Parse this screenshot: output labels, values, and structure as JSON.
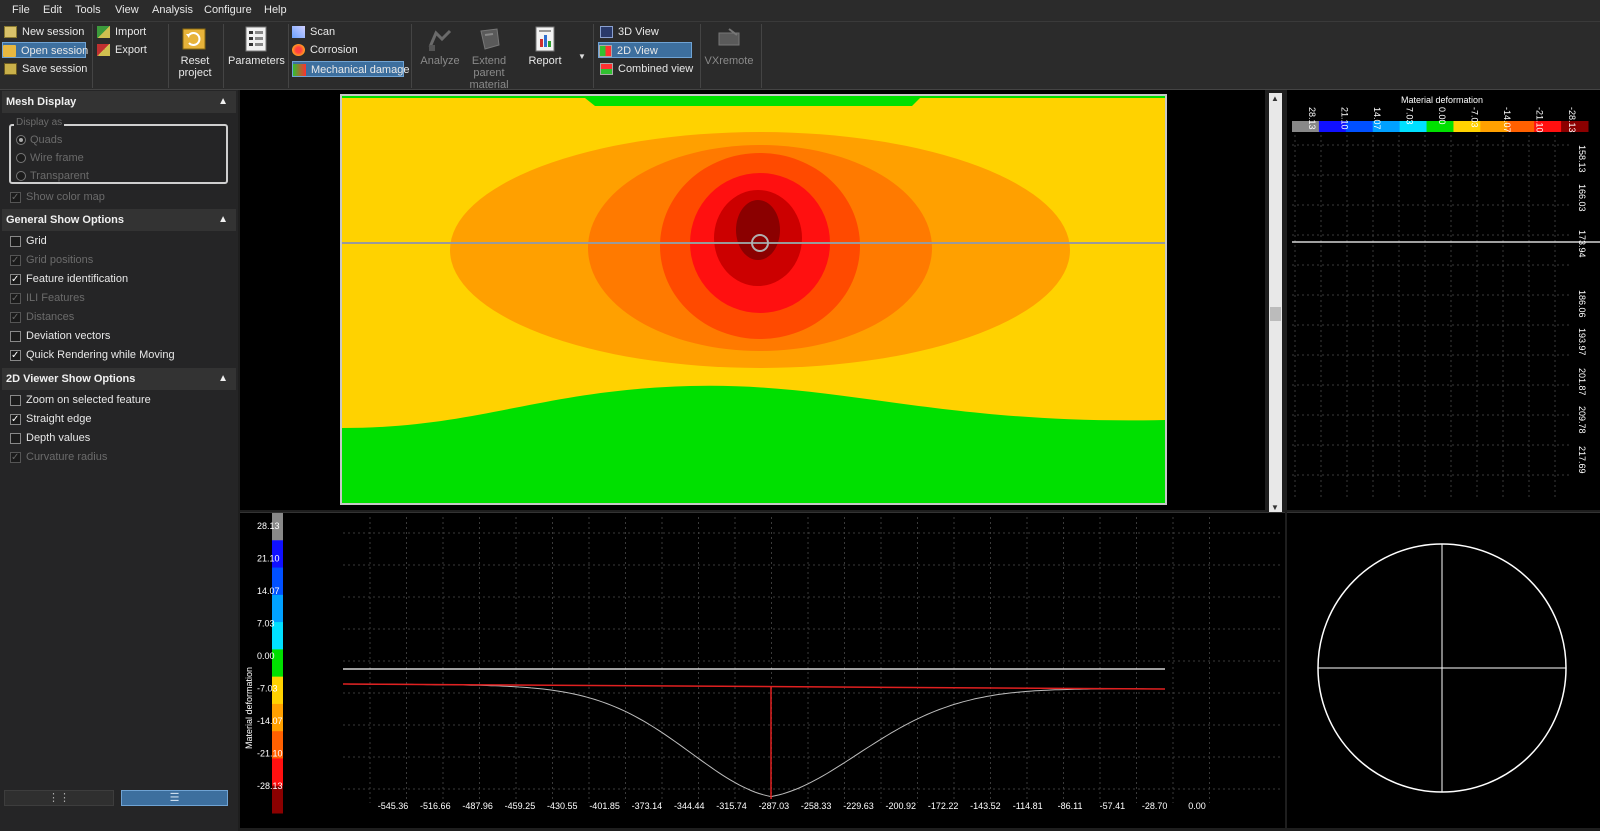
{
  "menu": [
    "File",
    "Edit",
    "Tools",
    "View",
    "Analysis",
    "Configure",
    "Help"
  ],
  "ribbon": {
    "session": {
      "new": "New session",
      "open": "Open session",
      "save": "Save session"
    },
    "io": {
      "import": "Import",
      "export": "Export"
    },
    "reset_line1": "Reset",
    "reset_line2": "project",
    "parameters": "Parameters",
    "modes": {
      "scan": "Scan",
      "corrosion": "Corrosion",
      "mechanical": "Mechanical damage"
    },
    "analyze": "Analyze",
    "extend_line1": "Extend",
    "extend_line2": "parent",
    "extend_line3": "material",
    "report": "Report",
    "views": {
      "v3d": "3D View",
      "v2d": "2D View",
      "combined": "Combined view"
    },
    "vxremote": "VXremote"
  },
  "left_panel": {
    "mesh_display": {
      "title": "Mesh Display",
      "display_as": "Display as",
      "radios": [
        "Quads",
        "Wire frame",
        "Transparent"
      ],
      "show_color_map": "Show color map"
    },
    "general": {
      "title": "General Show Options",
      "items": [
        {
          "label": "Grid",
          "checked": false,
          "enabled": true
        },
        {
          "label": "Grid positions",
          "checked": true,
          "enabled": false
        },
        {
          "label": "Feature identification",
          "checked": true,
          "enabled": true
        },
        {
          "label": "ILI Features",
          "checked": true,
          "enabled": false
        },
        {
          "label": "Distances",
          "checked": true,
          "enabled": false
        },
        {
          "label": "Deviation vectors",
          "checked": false,
          "enabled": true
        },
        {
          "label": "Quick Rendering while Moving",
          "checked": true,
          "enabled": true
        }
      ]
    },
    "viewer2d": {
      "title": "2D Viewer Show Options",
      "items": [
        {
          "label": "Zoom on selected feature",
          "checked": false,
          "enabled": true
        },
        {
          "label": "Straight edge",
          "checked": true,
          "enabled": true
        },
        {
          "label": "Depth values",
          "checked": false,
          "enabled": true
        },
        {
          "label": "Curvature radius",
          "checked": true,
          "enabled": false
        }
      ]
    }
  },
  "colors": {
    "yellow": "#ffd200",
    "orange": "#ffa000",
    "dark_orange": "#ff7a00",
    "red_orange": "#ff4a00",
    "red": "#ff1010",
    "dark_red": "#cc0000",
    "maroon": "#8b0000",
    "green": "#00e000",
    "accent_blue": "#3d6f9e"
  },
  "profile": {
    "axis_title": "Material deformation",
    "scale_labels": [
      "28.13",
      "21.10",
      "14.07",
      "7.03",
      "0.00",
      "-7.03",
      "-14.07",
      "-21.10",
      "-28.13"
    ],
    "x_labels": [
      "-545.36",
      "-516.66",
      "-487.96",
      "-459.25",
      "-430.55",
      "-401.85",
      "-373.14",
      "-344.44",
      "-315.74",
      "-287.03",
      "-258.33",
      "-229.63",
      "-200.92",
      "-172.22",
      "-143.52",
      "-114.81",
      "-86.11",
      "-57.41",
      "-28.70",
      "0.00"
    ]
  },
  "right_panel": {
    "title": "Material deformation",
    "scale_labels": [
      "28.13",
      "21.10",
      "14.07",
      "7.03",
      "0.00",
      "-7.03",
      "-14.07",
      "-21.10",
      "-28.13"
    ],
    "y_labels": [
      "158.13",
      "166.03",
      "173.94",
      "186.06",
      "193.97",
      "201.87",
      "209.78",
      "217.69"
    ]
  }
}
